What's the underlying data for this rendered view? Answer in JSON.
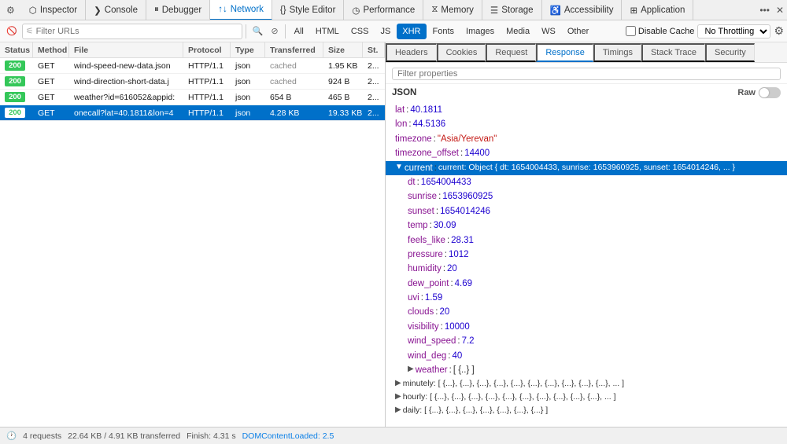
{
  "tabs": [
    {
      "id": "inspector",
      "label": "Inspector",
      "icon": "⬡"
    },
    {
      "id": "console",
      "label": "Console",
      "icon": "❯"
    },
    {
      "id": "debugger",
      "label": "Debugger",
      "icon": "⏸"
    },
    {
      "id": "network",
      "label": "Network",
      "icon": "↑↓",
      "active": true
    },
    {
      "id": "style-editor",
      "label": "Style Editor",
      "icon": "{}"
    },
    {
      "id": "performance",
      "label": "Performance",
      "icon": "◷"
    },
    {
      "id": "memory",
      "label": "Memory",
      "icon": "⧖"
    },
    {
      "id": "storage",
      "label": "Storage",
      "icon": "☰"
    },
    {
      "id": "accessibility",
      "label": "Accessibility",
      "icon": "♿"
    },
    {
      "id": "application",
      "label": "Application",
      "icon": "⊞"
    }
  ],
  "filter_bar": {
    "filter_placeholder": "Filter URLs",
    "type_buttons": [
      "All",
      "HTML",
      "CSS",
      "JS",
      "XHR",
      "Fonts",
      "Images",
      "Media",
      "WS",
      "Other"
    ],
    "active_type": "XHR",
    "disable_cache_label": "Disable Cache",
    "throttle_value": "No Throttling"
  },
  "table": {
    "columns": [
      "Status",
      "Method",
      "File",
      "Protocol",
      "Type",
      "Transferred",
      "Size",
      "St."
    ],
    "rows": [
      {
        "status": "200",
        "method": "GET",
        "file": "wind-speed-new-data.json",
        "protocol": "HTTP/1.1",
        "type": "json",
        "transferred": "cached",
        "size": "1.95 KB",
        "st": "2...",
        "selected": false
      },
      {
        "status": "200",
        "method": "GET",
        "file": "wind-direction-short-data.j",
        "protocol": "HTTP/1.1",
        "type": "json",
        "transferred": "cached",
        "size": "924 B",
        "st": "2...",
        "selected": false
      },
      {
        "status": "200",
        "method": "GET",
        "file": "weather?id=616052&appid:",
        "protocol": "HTTP/1.1",
        "type": "json",
        "transferred": "654 B",
        "size": "465 B",
        "st": "2...",
        "selected": false
      },
      {
        "status": "200",
        "method": "GET",
        "file": "onecall?lat=40.1811&lon=4",
        "protocol": "HTTP/1.1",
        "type": "json",
        "transferred": "4.28 KB",
        "size": "19.33 KB",
        "st": "2...",
        "selected": true
      }
    ]
  },
  "right_tabs": [
    "Headers",
    "Cookies",
    "Request",
    "Response",
    "Timings",
    "Stack Trace",
    "Security"
  ],
  "active_right_tab": "Response",
  "response_filter_placeholder": "Filter properties",
  "json_label": "JSON",
  "raw_label": "Raw",
  "json_data": {
    "lat": "40.1811",
    "lon": "44.5136",
    "timezone": "\"Asia/Yerevan\"",
    "timezone_offset": "14400",
    "current_label": "current: Object { dt: 1654004433, sunrise: 1653960925, sunset: 1654014246, ... }",
    "current_fields": [
      {
        "key": "dt",
        "val": "1654004433",
        "type": "num"
      },
      {
        "key": "sunrise",
        "val": "1653960925",
        "type": "num"
      },
      {
        "key": "sunset",
        "val": "1654014246",
        "type": "num"
      },
      {
        "key": "temp",
        "val": "30.09",
        "type": "num"
      },
      {
        "key": "feels_like",
        "val": "28.31",
        "type": "num"
      },
      {
        "key": "pressure",
        "val": "1012",
        "type": "num"
      },
      {
        "key": "humidity",
        "val": "20",
        "type": "num"
      },
      {
        "key": "dew_point",
        "val": "4.69",
        "type": "num"
      },
      {
        "key": "uvi",
        "val": "1.59",
        "type": "num"
      },
      {
        "key": "clouds",
        "val": "20",
        "type": "num"
      },
      {
        "key": "visibility",
        "val": "10000",
        "type": "num"
      },
      {
        "key": "wind_speed",
        "val": "7.2",
        "type": "num"
      },
      {
        "key": "wind_deg",
        "val": "40",
        "type": "num"
      },
      {
        "key": "weather",
        "val": "[ {..} ]",
        "type": "obj"
      }
    ],
    "minutely": "minutely: [ {...}, {...}, {...}, {...}, {...}, {...}, {...}, {...}, {...}, {...}, ... ]",
    "hourly": "hourly: [ {...}, {...}, {...}, {...}, {...}, {...}, {...}, {...}, {...}, {...}, ... ]",
    "daily": "daily: [ {...}, {...}, {...}, {...}, {...}, {...}, {...} ]"
  },
  "bottom_bar": {
    "requests": "4 requests",
    "size": "22.64 KB / 4.91 KB transferred",
    "finish": "Finish: 4.31 s",
    "dom_loaded": "DOMContentLoaded: 2.5"
  }
}
